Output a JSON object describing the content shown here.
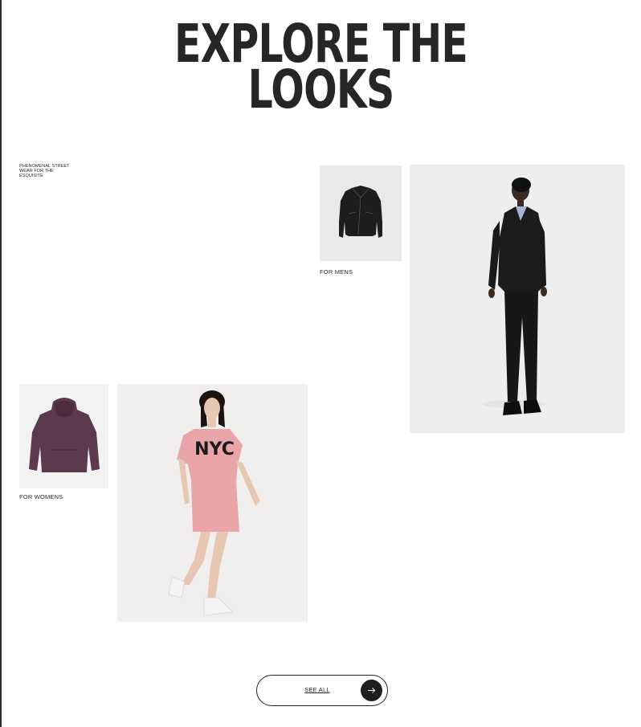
{
  "heading": {
    "line1": "EXPLORE THE",
    "line2": "LOOKS"
  },
  "tagline": "PHENOMENAL STREET WEAR FOR THE ESQUISITE",
  "mens": {
    "caption": "FOR MENS"
  },
  "womens": {
    "caption": "FOR WOMENS",
    "shirt_print": "NYC"
  },
  "cta": {
    "label": "SEE ALL",
    "icon": "arrow-right-icon"
  },
  "colors": {
    "text": "#262626",
    "jacket": "#1d1d1d",
    "hoodie": "#5a3a4c",
    "dress": "#e9a5a8"
  }
}
